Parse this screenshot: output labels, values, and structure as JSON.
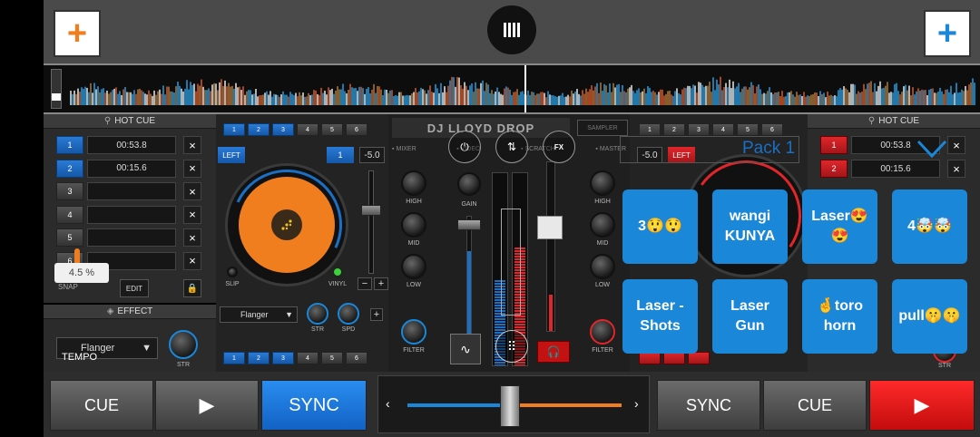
{
  "header": {
    "title": "DJ LLOYD DROP"
  },
  "left_deck": {
    "hot_cue_label": "HOT CUE",
    "hot_cues": [
      {
        "num": "1",
        "time": "00:53.8",
        "active": true
      },
      {
        "num": "2",
        "time": "00:15.6",
        "active": true
      },
      {
        "num": "3",
        "time": "",
        "active": false
      },
      {
        "num": "4",
        "time": "",
        "active": false
      },
      {
        "num": "5",
        "time": "",
        "active": false
      },
      {
        "num": "6",
        "time": "",
        "active": false
      }
    ],
    "snap_label": "SNAP",
    "edit_label": "EDIT",
    "effect_label": "EFFECT",
    "effect_select": "Flanger",
    "str_label": "STR",
    "tempo_label": "TEMPO",
    "tempo_value": "4.5 %",
    "pitch_value": "-5.0",
    "left_label": "LEFT",
    "deck_num": "1",
    "slip_label": "SLIP",
    "vinyl_label": "VINYL",
    "fx_select": "Flanger",
    "str2_label": "STR",
    "spd_label": "SPD",
    "loop_buttons": [
      "1",
      "2",
      "3",
      "4",
      "5",
      "6"
    ],
    "sampler_buttons": [
      "1",
      "2",
      "3",
      "4",
      "5",
      "6"
    ]
  },
  "right_deck": {
    "hot_cue_label": "HOT CUE",
    "hot_cues": [
      {
        "num": "1",
        "time": "00:53.8"
      },
      {
        "num": "2",
        "time": "00:15.6"
      }
    ],
    "pitch_value": "-5.0",
    "left_label": "LEFT",
    "loop_buttons": [
      "1",
      "2",
      "3",
      "4",
      "5",
      "6"
    ],
    "str_label": "STR"
  },
  "mixer": {
    "tabs": [
      "MIXER",
      "VIDEO",
      "SCRATCH",
      "MASTER"
    ],
    "sampler_label": "SAMPLER",
    "knob_labels_left": [
      "HIGH",
      "MID",
      "LOW",
      "FILTER"
    ],
    "knob_labels_right": [
      "HIGH",
      "MID",
      "LOW",
      "FILTER"
    ],
    "gain_label": "GAIN",
    "fx_label": "FX"
  },
  "pack": {
    "title": "Pack 1",
    "buttons": [
      "3😲😲",
      "wangi KUNYA",
      "Laser😍😍",
      "4🤯🤯",
      "Laser - Shots",
      "Laser Gun",
      "🤞toro horn",
      "pull🤫🤫"
    ]
  },
  "transport": {
    "left": {
      "cue": "CUE",
      "play": "▶",
      "sync": "SYNC"
    },
    "right": {
      "sync": "SYNC",
      "cue": "CUE",
      "play": "▶"
    }
  },
  "colors": {
    "accent_blue": "#1b87d9",
    "accent_orange": "#f07d1e",
    "accent_red": "#e0262a"
  }
}
